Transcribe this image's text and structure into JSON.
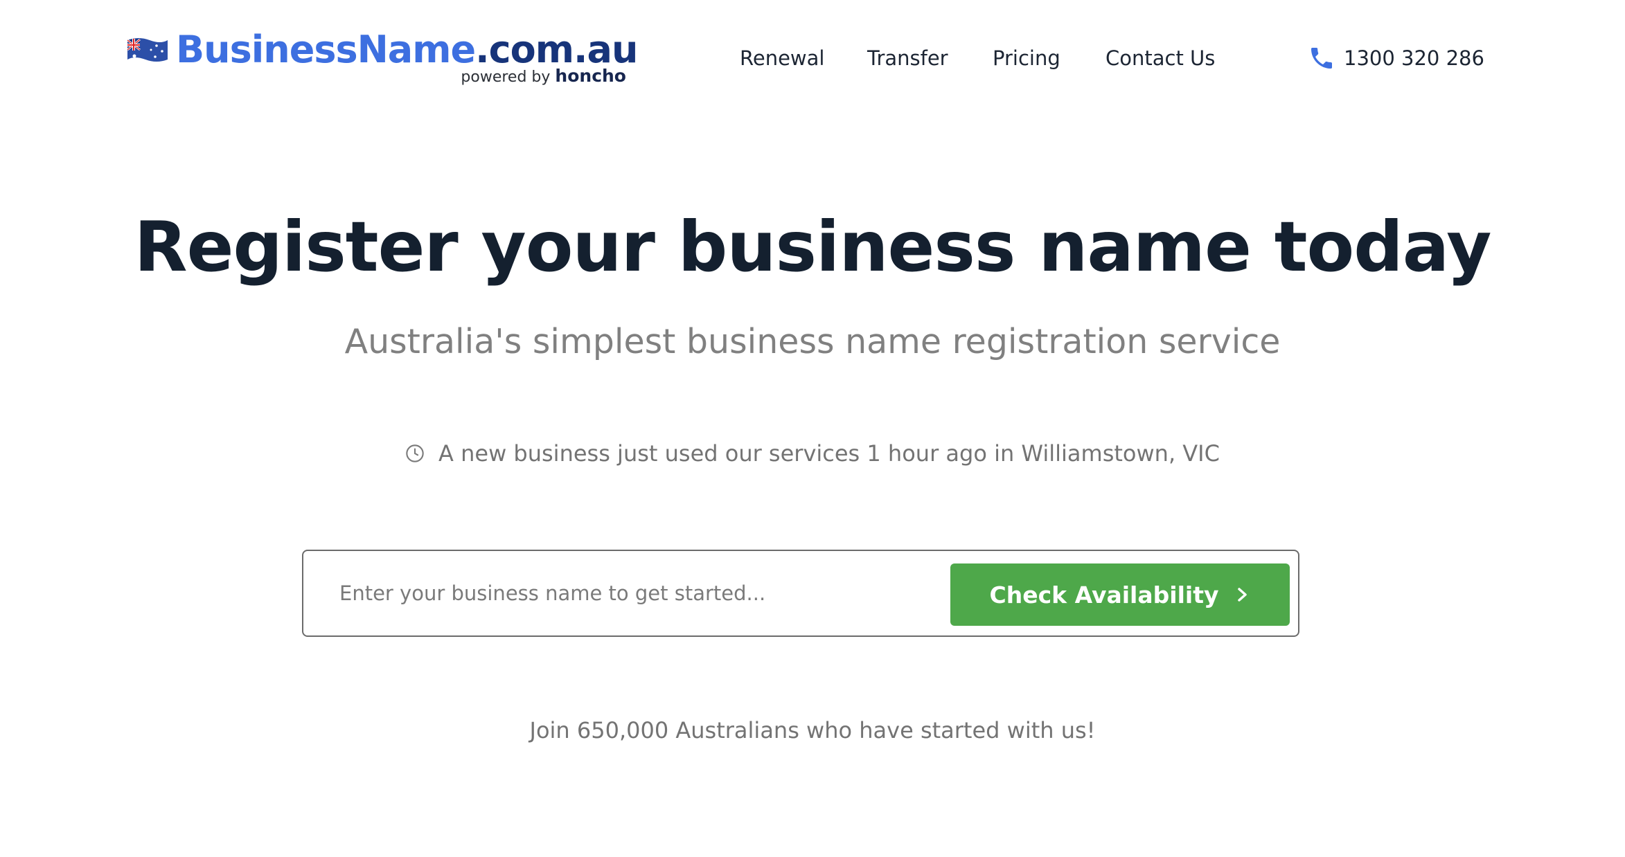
{
  "header": {
    "logo": {
      "brand": "BusinessName",
      "tld": ".com.au",
      "powered_by": "powered by",
      "partner": "honcho",
      "flag_icon": "australian-flag-icon"
    },
    "nav": [
      {
        "label": "Renewal"
      },
      {
        "label": "Transfer"
      },
      {
        "label": "Pricing"
      },
      {
        "label": "Contact Us"
      }
    ],
    "phone": {
      "icon": "phone-icon",
      "number": "1300 320 286"
    }
  },
  "hero": {
    "title": "Register your business name today",
    "subtitle": "Australia's simplest business name registration service"
  },
  "activity": {
    "icon": "clock-icon",
    "text": "A new business just used our services 1 hour ago in Williamstown, VIC"
  },
  "search": {
    "placeholder": "Enter your business name to get started...",
    "value": "",
    "button_label": "Check Availability",
    "button_icon": "chevron-right-icon"
  },
  "footer_note": "Join 650,000 Australians who have started with us!",
  "colors": {
    "brand_blue": "#3d6fe0",
    "brand_navy": "#17347a",
    "cta_green": "#4ea84a",
    "heading": "#14202f",
    "muted": "#808080"
  }
}
